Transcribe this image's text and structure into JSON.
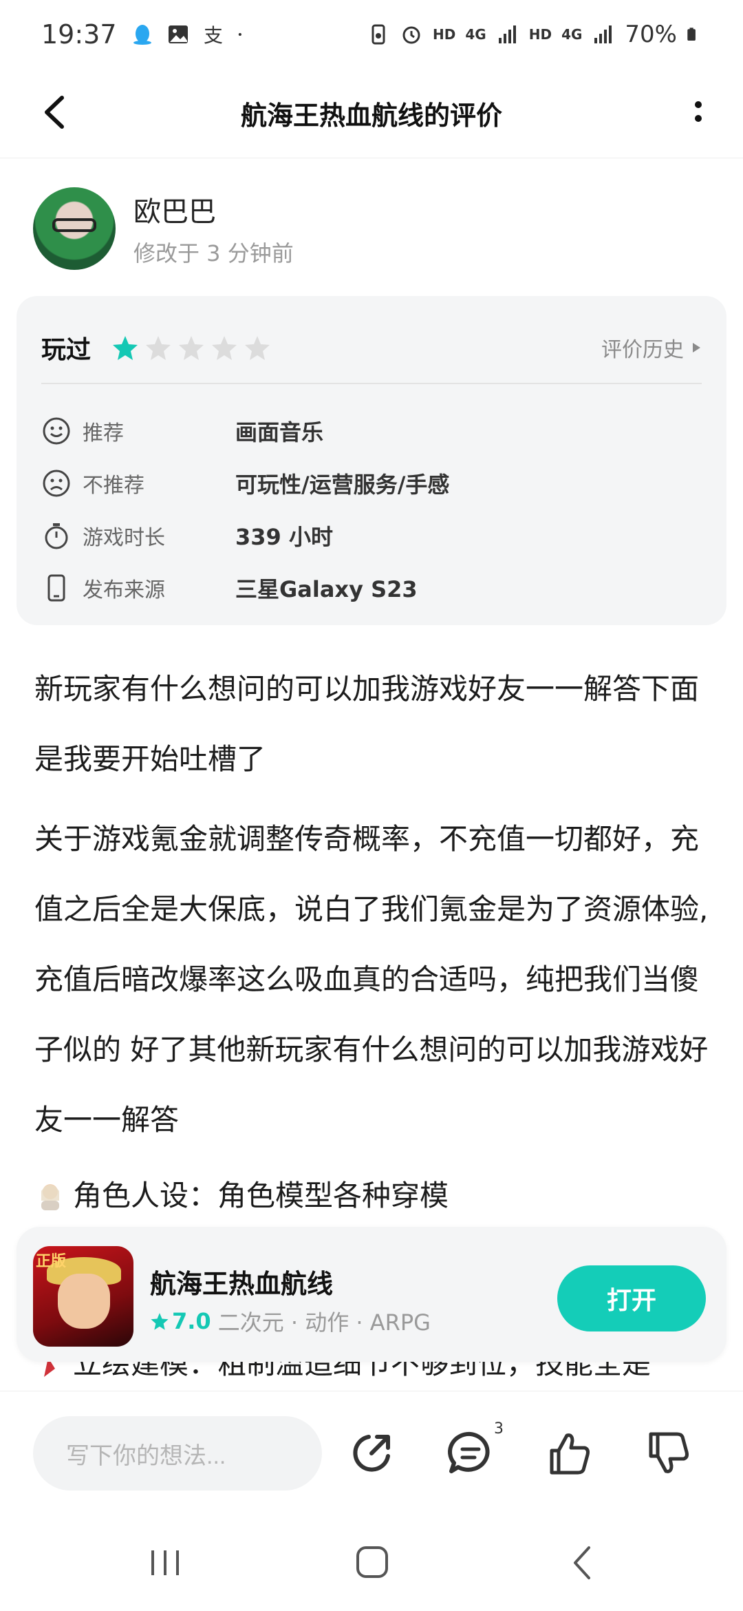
{
  "status_bar": {
    "time": "19:37",
    "battery": "70%",
    "net1": "HD",
    "net2": "4G",
    "net3": "HD",
    "net4": "4G"
  },
  "header": {
    "title": "航海王热血航线的评价"
  },
  "author": {
    "name": "欧巴巴",
    "modified": "修改于 3 分钟前"
  },
  "rating_card": {
    "played_label": "玩过",
    "stars_filled": 1,
    "stars_total": 5,
    "star_color": "#14c8b4",
    "history_label": "评价历史",
    "rows": [
      {
        "icon": "smile-icon",
        "label": "推荐",
        "value": "画面音乐"
      },
      {
        "icon": "frown-icon",
        "label": "不推荐",
        "value": "可玩性/运营服务/手感"
      },
      {
        "icon": "stopwatch-icon",
        "label": "游戏时长",
        "value": "339 小时"
      },
      {
        "icon": "phone-icon",
        "label": "发布来源",
        "value": "三星Galaxy S23"
      }
    ]
  },
  "content": {
    "paragraph1": "新玩家有什么想问的可以加我游戏好友一一解答下面是我要开始吐槽了",
    "paragraph2": "关于游戏氪金就调整传奇概率，不充值一切都好，充值之后全是大保底，说白了我们氪金是为了资源体验,充值后暗改爆率这么吸血真的合适吗，纯把我们当傻子似的 好了其他新玩家有什么想问的可以加我游戏好友一一解答",
    "bullet1": "角色人设：角色模型各种穿模",
    "bullet2": "立绘建模：粗制滥造细节不够到位，技能全是"
  },
  "game_card": {
    "badge": "正版",
    "name": "航海王热血航线",
    "score": "7.0",
    "tags": "二次元 · 动作 · ARPG",
    "open_label": "打开",
    "accent": "#14cdb8"
  },
  "action_bar": {
    "comment_placeholder": "写下你的想法...",
    "comment_count": "3"
  }
}
